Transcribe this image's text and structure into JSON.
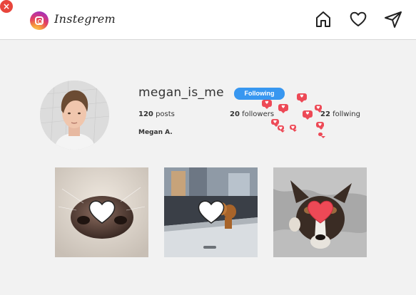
{
  "app": {
    "brand": "Instegrem",
    "close_glyph": "×"
  },
  "nav": {
    "icons": [
      "home-icon",
      "heart-icon",
      "send-icon"
    ]
  },
  "profile": {
    "username": "megan_is_me",
    "follow_label": "Following",
    "posts_count": "120",
    "posts_label": "posts",
    "followers_count": "20",
    "followers_label": "followers",
    "following_count": "22",
    "following_label": "follwing",
    "full_name": "Megan A."
  },
  "posts": [
    {
      "subject": "dog-nose-photo",
      "heart": "white"
    },
    {
      "subject": "dog-in-car-photo",
      "heart": "white"
    },
    {
      "subject": "collie-on-blanket-photo",
      "heart": "red"
    }
  ],
  "colors": {
    "accent": "#3897f0",
    "notification": "#ed4956",
    "liked": "#ed4956"
  }
}
